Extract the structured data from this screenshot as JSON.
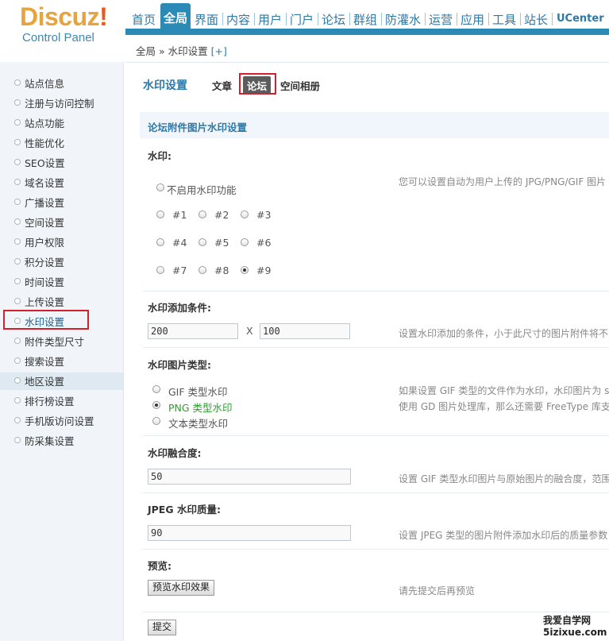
{
  "header": {
    "logo_text": "Discuz!",
    "logo_sub": "Control Panel",
    "nav": [
      "首页",
      "全局",
      "界面",
      "内容",
      "用户",
      "门户",
      "论坛",
      "群组",
      "防灌水",
      "运营",
      "应用",
      "工具",
      "站长",
      "UCenter"
    ],
    "active_nav": "全局"
  },
  "breadcrumb": {
    "path": "全局 » 水印设置",
    "plus": "[+]"
  },
  "sidebar": {
    "items": [
      "站点信息",
      "注册与访问控制",
      "站点功能",
      "性能优化",
      "SEO设置",
      "域名设置",
      "广播设置",
      "空间设置",
      "用户权限",
      "积分设置",
      "时间设置",
      "上传设置",
      "水印设置",
      "附件类型尺寸",
      "搜索设置",
      "地区设置",
      "排行榜设置",
      "手机版访问设置",
      "防采集设置"
    ],
    "active": "水印设置"
  },
  "tabs": {
    "title": "水印设置",
    "items": [
      "文章",
      "论坛",
      "空间相册"
    ],
    "active": "论坛"
  },
  "section_title": "论坛附件图片水印设置",
  "watermark": {
    "label": "水印:",
    "hint": "您可以设置自动为用户上传的 JPG/PNG/GIF 图片",
    "disable_label": "不启用水印功能",
    "positions": [
      "#1",
      "#2",
      "#3",
      "#4",
      "#5",
      "#6",
      "#7",
      "#8",
      "#9"
    ],
    "selected": "#9"
  },
  "condition": {
    "label": "水印添加条件:",
    "width": "200",
    "x": "X",
    "height": "100",
    "hint": "设置水印添加的条件，小于此尺寸的图片附件将不"
  },
  "image_type": {
    "label": "水印图片类型:",
    "options": [
      "GIF 类型水印",
      "PNG 类型水印",
      "文本类型水印"
    ],
    "selected": "PNG 类型水印",
    "hint1": "如果设置 GIF 类型的文件作为水印，水印图片为 s",
    "hint2": "使用 GD 图片处理库，那么还需要 FreeType 库支"
  },
  "blend": {
    "label": "水印融合度:",
    "value": "50",
    "hint": "设置 GIF 类型水印图片与原始图片的融合度，范围"
  },
  "jpeg": {
    "label": "JPEG 水印质量:",
    "value": "90",
    "hint": "设置 JPEG 类型的图片附件添加水印后的质量参数"
  },
  "preview": {
    "label": "预览:",
    "button": "预览水印效果",
    "hint": "请先提交后再预览"
  },
  "submit": "提交",
  "watermark_site": {
    "line1": "我爱自学网",
    "line2": "5izixue.com"
  },
  "colors": {
    "accent": "#2b8ab6",
    "highlight": "#d2212b",
    "green_label": "#2ba02b"
  }
}
